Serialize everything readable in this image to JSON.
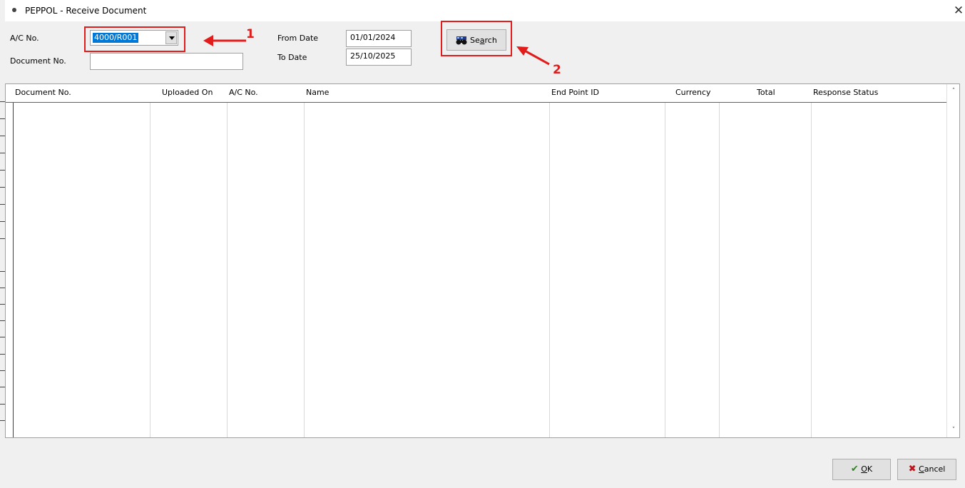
{
  "window": {
    "title": "PEPPOL - Receive Document",
    "close_glyph": "✕"
  },
  "filters": {
    "ac_no_label": "A/C No.",
    "ac_no_value": "4000/R001",
    "document_no_label": "Document No.",
    "document_no_value": "",
    "from_date_label": "From Date",
    "from_date_value": "01/01/2024",
    "to_date_label": "To Date",
    "to_date_value": "25/10/2025",
    "search_label_pre": "Se",
    "search_label_ul": "a",
    "search_label_post": "rch"
  },
  "annotations": {
    "marker_1": "1",
    "marker_2": "2",
    "color": "#e21b1b"
  },
  "grid": {
    "columns": [
      "Document No.",
      "Uploaded On",
      "A/C No.",
      "Name",
      "End Point ID",
      "Currency",
      "Total",
      "Response Status"
    ],
    "rows": []
  },
  "footer": {
    "ok_ul": "O",
    "ok_post": "K",
    "cancel_ul": "C",
    "cancel_post": "ancel"
  }
}
